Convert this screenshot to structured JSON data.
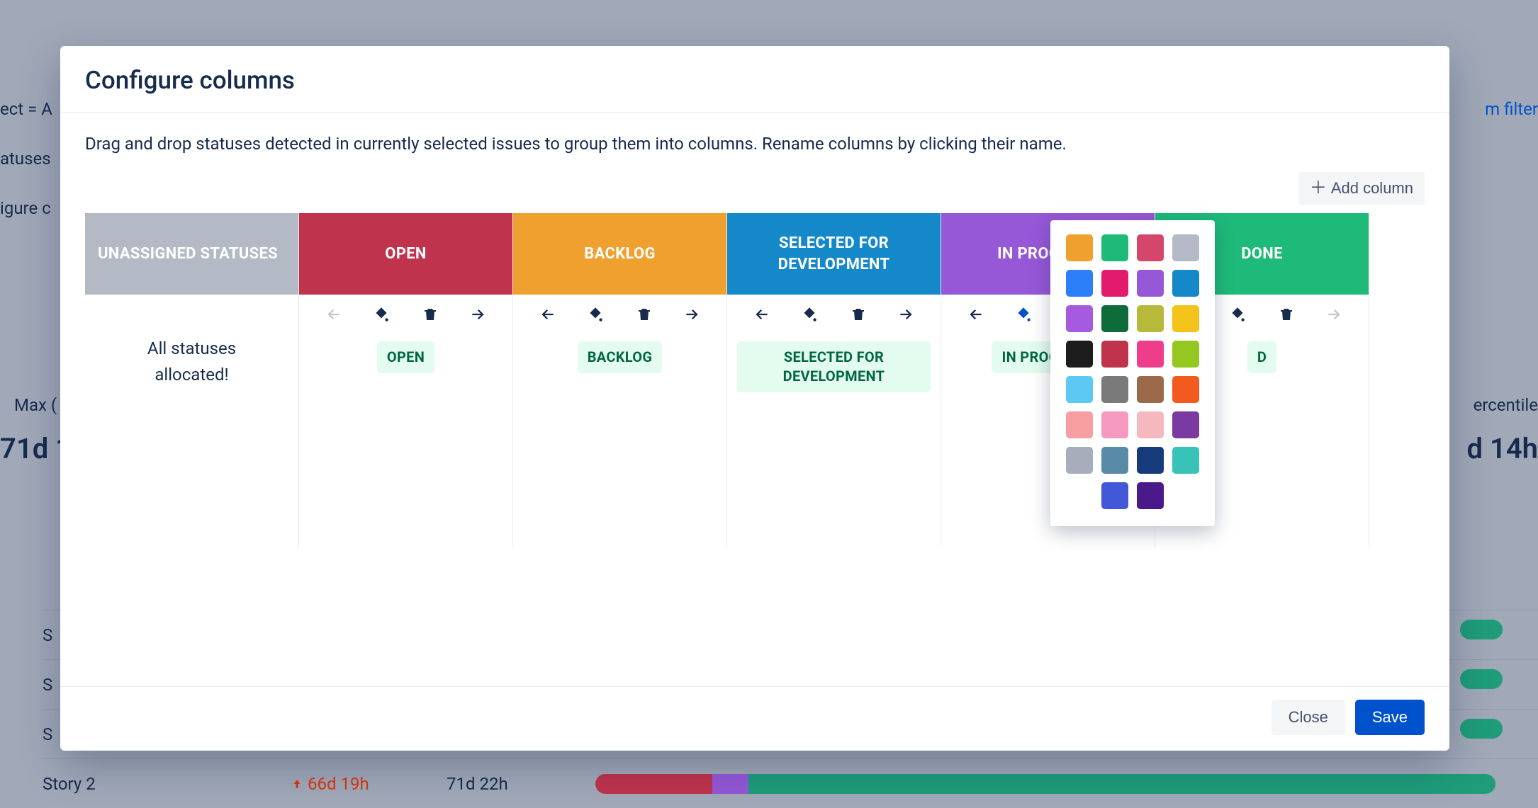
{
  "bg": {
    "top_left_fragment": "ect = A",
    "row2_fragment": "atuses",
    "row3_fragment": "igure c",
    "right_link_fragment": "m filter",
    "metric_left_label": "Max (",
    "metric_left_value": "71d 1",
    "metric_right_label": "ercentile",
    "metric_right_value": "d 14h",
    "story_rows": [
      {
        "name": "S",
        "dur1": "",
        "dur2": ""
      },
      {
        "name": "S",
        "dur1": "",
        "dur2": ""
      },
      {
        "name": "S",
        "dur1": "",
        "dur2": ""
      },
      {
        "name": "Story 2",
        "dur1": "66d 19h",
        "dur2": "71d 22h"
      }
    ]
  },
  "modal": {
    "title": "Configure columns",
    "instructions": "Drag and drop statuses detected in currently selected issues to group them into columns. Rename columns by clicking their name.",
    "add_column_label": "Add column",
    "close_label": "Close",
    "save_label": "Save"
  },
  "columns": [
    {
      "id": "unassigned",
      "header": "UNASSIGNED STATUSES",
      "header_color": "#b3bac5",
      "header_text_align": "left",
      "is_unassigned": true,
      "unassigned_message": "All statuses allocated!"
    },
    {
      "id": "open",
      "header": "OPEN",
      "header_color": "#c0334d",
      "statuses": [
        "OPEN"
      ],
      "move_left_disabled": true
    },
    {
      "id": "backlog",
      "header": "BACKLOG",
      "header_color": "#f0a02e",
      "statuses": [
        "BACKLOG"
      ]
    },
    {
      "id": "selected",
      "header": "SELECTED FOR DEVELOPMENT",
      "header_color": "#1588c9",
      "statuses": [
        "SELECTED FOR DEVELOPMENT"
      ]
    },
    {
      "id": "inprogress",
      "header": "IN PROGRESS",
      "header_color": "#9658d7",
      "statuses": [
        "IN PROGRESS"
      ],
      "color_active": true
    },
    {
      "id": "done",
      "header": "DONE",
      "header_color": "#1eba7a",
      "statuses": [
        "D"
      ],
      "move_right_disabled": true
    }
  ],
  "color_swatches": [
    "#f0a02e",
    "#1eba7a",
    "#d4476a",
    "#b3bac5",
    "#2d7ff9",
    "#e31b6d",
    "#9658d7",
    "#1588c9",
    "#a55ae0",
    "#0e6b3a",
    "#b7b93a",
    "#f3c21b",
    "#1d1d1d",
    "#c0334d",
    "#ee3d8b",
    "#94c720",
    "#5cc9f5",
    "#7a7a7a",
    "#9b6a4a",
    "#f25a1f",
    "#f79ea3",
    "#f49ac1",
    "#f6b8bf",
    "#7b3aa0",
    "#a7adba",
    "#5a8ba6",
    "#163a7a",
    "#38c2b8",
    "",
    "#4258d6",
    "#4a1a8c",
    ""
  ]
}
